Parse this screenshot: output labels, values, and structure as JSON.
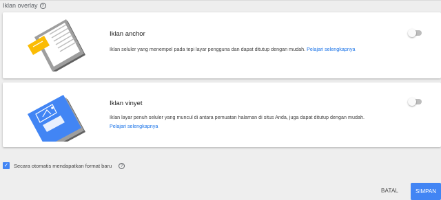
{
  "section": {
    "title": "Iklan overlay",
    "help_icon": "help-circle-icon"
  },
  "cards": [
    {
      "title": "Iklan anchor",
      "description": "Iklan seluler yang menempel pada tepi layar pengguna dan dapat ditutup dengan mudah.",
      "link": "Pelajari selengkapnya",
      "enabled": false
    },
    {
      "title": "Iklan vinyet",
      "description": "Iklan layar penuh seluler yang muncul di antara pemuatan halaman di situs Anda, juga dapat ditutup dengan mudah.",
      "link": "Pelajari selengkapnya",
      "enabled": false
    }
  ],
  "auto_format": {
    "label": "Secara otomatis mendapatkan format baru",
    "checked": true
  },
  "actions": {
    "cancel_label": "BATAL",
    "save_label": "SIMPAN"
  },
  "colors": {
    "accent": "#4285f4",
    "link": "#1a73e8",
    "anchor_ad": "#fbbc04"
  }
}
